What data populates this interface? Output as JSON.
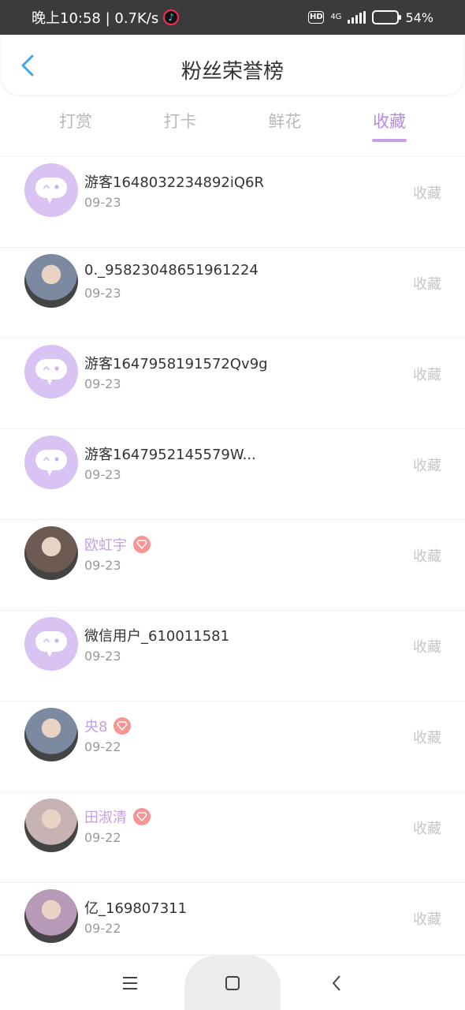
{
  "status_bar": {
    "time_and_speed": "晚上10:58 | 0.7K/s",
    "hd": "HD",
    "network": "4G",
    "battery_percent": "54%",
    "battery_level": 0.54,
    "battery_color": "#f3a52b"
  },
  "header": {
    "title": "粉丝荣誉榜",
    "back_icon": "chevron-left-icon",
    "accent_color": "#3aa7e6"
  },
  "tabs": [
    {
      "label": "打赏",
      "active": false
    },
    {
      "label": "打卡",
      "active": false
    },
    {
      "label": "鲜花",
      "active": false
    },
    {
      "label": "收藏",
      "active": true
    }
  ],
  "list": [
    {
      "name": "游客1648032234892iQ6R",
      "date": "09-23",
      "action": "收藏",
      "avatar": "default-chat-avatar",
      "vip": false
    },
    {
      "name": "0._95823048651961224",
      "date": "09-23",
      "action": "收藏",
      "avatar": "user-photo-avatar",
      "vip": false
    },
    {
      "name": "游客1647958191572Qv9g",
      "date": "09-23",
      "action": "收藏",
      "avatar": "default-chat-avatar",
      "vip": false
    },
    {
      "name": "游客1647952145579W...",
      "date": "09-23",
      "action": "收藏",
      "avatar": "default-chat-avatar",
      "vip": false
    },
    {
      "name": "欧虹宇",
      "date": "09-23",
      "action": "收藏",
      "avatar": "user-photo-avatar",
      "vip": true
    },
    {
      "name": "微信用户_610011581",
      "date": "09-23",
      "action": "收藏",
      "avatar": "default-chat-avatar",
      "vip": false
    },
    {
      "name": "央8",
      "date": "09-22",
      "action": "收藏",
      "avatar": "user-photo-avatar",
      "vip": true
    },
    {
      "name": "田淑清",
      "date": "09-22",
      "action": "收藏",
      "avatar": "user-photo-avatar",
      "vip": true
    },
    {
      "name": "亿_169807311",
      "date": "09-22",
      "action": "收藏",
      "avatar": "user-photo-avatar",
      "vip": false
    }
  ],
  "bottom_nav": {
    "menu_icon": "menu-icon",
    "home_icon": "home-square-icon",
    "back_icon": "back-triangle-icon"
  },
  "colors": {
    "tab_active": "#b48bdc",
    "vip_name": "#c4a0e6",
    "vip_badge": "#f79595",
    "avatar_default": "#d8c3f3"
  }
}
